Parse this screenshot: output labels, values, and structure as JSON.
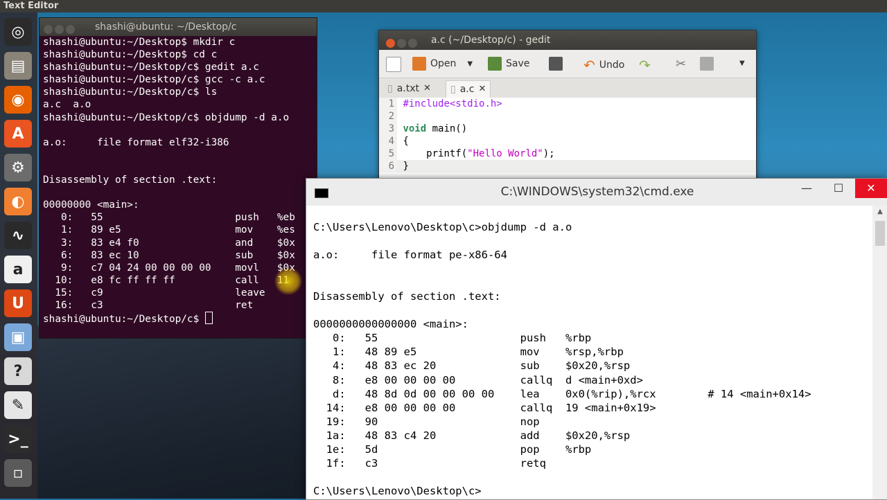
{
  "top_panel": {
    "title": "Text Editor"
  },
  "launcher": {
    "items": [
      {
        "name": "dash-icon",
        "glyph": "◎",
        "color": "#2b2b2b"
      },
      {
        "name": "files-icon",
        "glyph": "▤",
        "color": "#8a8378"
      },
      {
        "name": "firefox-icon",
        "glyph": "◉",
        "color": "#e66000"
      },
      {
        "name": "software-center-icon",
        "glyph": "A",
        "color": "#e95420"
      },
      {
        "name": "settings-icon",
        "glyph": "⚙",
        "color": "#6c6c6c"
      },
      {
        "name": "orange-app-icon",
        "glyph": "◐",
        "color": "#f08030"
      },
      {
        "name": "system-monitor-icon",
        "glyph": "∿",
        "color": "#2a2a2a"
      },
      {
        "name": "amazon-icon",
        "glyph": "a",
        "color": "#f0f0f0"
      },
      {
        "name": "ubuntu-one-icon",
        "glyph": "U",
        "color": "#dd4814"
      },
      {
        "name": "box-icon",
        "glyph": "▣",
        "color": "#7aa7d9"
      },
      {
        "name": "help-icon",
        "glyph": "?",
        "color": "#d8d8d8"
      },
      {
        "name": "text-editor-icon",
        "glyph": "✎",
        "color": "#e6e6e6"
      },
      {
        "name": "terminal-icon",
        "glyph": ">_",
        "color": "#2c2c2c"
      },
      {
        "name": "save-disk-icon",
        "glyph": "▫",
        "color": "#5a5a5a"
      }
    ]
  },
  "terminal": {
    "title": "shashi@ubuntu: ~/Desktop/c",
    "lines": [
      "shashi@ubuntu:~/Desktop$ mkdir c",
      "shashi@ubuntu:~/Desktop$ cd c",
      "shashi@ubuntu:~/Desktop/c$ gedit a.c",
      "shashi@ubuntu:~/Desktop/c$ gcc -c a.c",
      "shashi@ubuntu:~/Desktop/c$ ls",
      "a.c  a.o",
      "shashi@ubuntu:~/Desktop/c$ objdump -d a.o",
      "",
      "a.o:     file format elf32-i386",
      "",
      "",
      "Disassembly of section .text:",
      "",
      "00000000 <main>:",
      "   0:   55                      push   %eb",
      "   1:   89 e5                   mov    %es",
      "   3:   83 e4 f0                and    $0x",
      "   6:   83 ec 10                sub    $0x",
      "   9:   c7 04 24 00 00 00 00    movl   $0x",
      "  10:   e8 fc ff ff ff          call   11",
      "  15:   c9                      leave",
      "  16:   c3                      ret"
    ],
    "prompt": "shashi@ubuntu:~/Desktop/c$ "
  },
  "gedit": {
    "title": "a.c (~/Desktop/c) - gedit",
    "toolbar": {
      "open": "Open",
      "save": "Save",
      "undo": "Undo"
    },
    "tabs": [
      {
        "label": "a.txt"
      },
      {
        "label": "a.c"
      }
    ],
    "code": [
      {
        "n": "1",
        "text": "#include<stdio.h>"
      },
      {
        "n": "2",
        "text": ""
      },
      {
        "n": "3",
        "text": "void main()"
      },
      {
        "n": "4",
        "text": "{"
      },
      {
        "n": "5",
        "text": "    printf(\"Hello World\");"
      },
      {
        "n": "6",
        "text": "}"
      }
    ]
  },
  "cmd": {
    "title": "C:\\WINDOWS\\system32\\cmd.exe",
    "lines": [
      "C:\\Users\\Lenovo\\Desktop\\c>objdump -d a.o",
      "",
      "a.o:     file format pe-x86-64",
      "",
      "",
      "Disassembly of section .text:",
      "",
      "0000000000000000 <main>:",
      "   0:   55                      push   %rbp",
      "   1:   48 89 e5                mov    %rsp,%rbp",
      "   4:   48 83 ec 20             sub    $0x20,%rsp",
      "   8:   e8 00 00 00 00          callq  d <main+0xd>",
      "   d:   48 8d 0d 00 00 00 00    lea    0x0(%rip),%rcx        # 14 <main+0x14>",
      "  14:   e8 00 00 00 00          callq  19 <main+0x19>",
      "  19:   90                      nop",
      "  1a:   48 83 c4 20             add    $0x20,%rsp",
      "  1e:   5d                      pop    %rbp",
      "  1f:   c3                      retq",
      "",
      "C:\\Users\\Lenovo\\Desktop\\c>"
    ]
  }
}
